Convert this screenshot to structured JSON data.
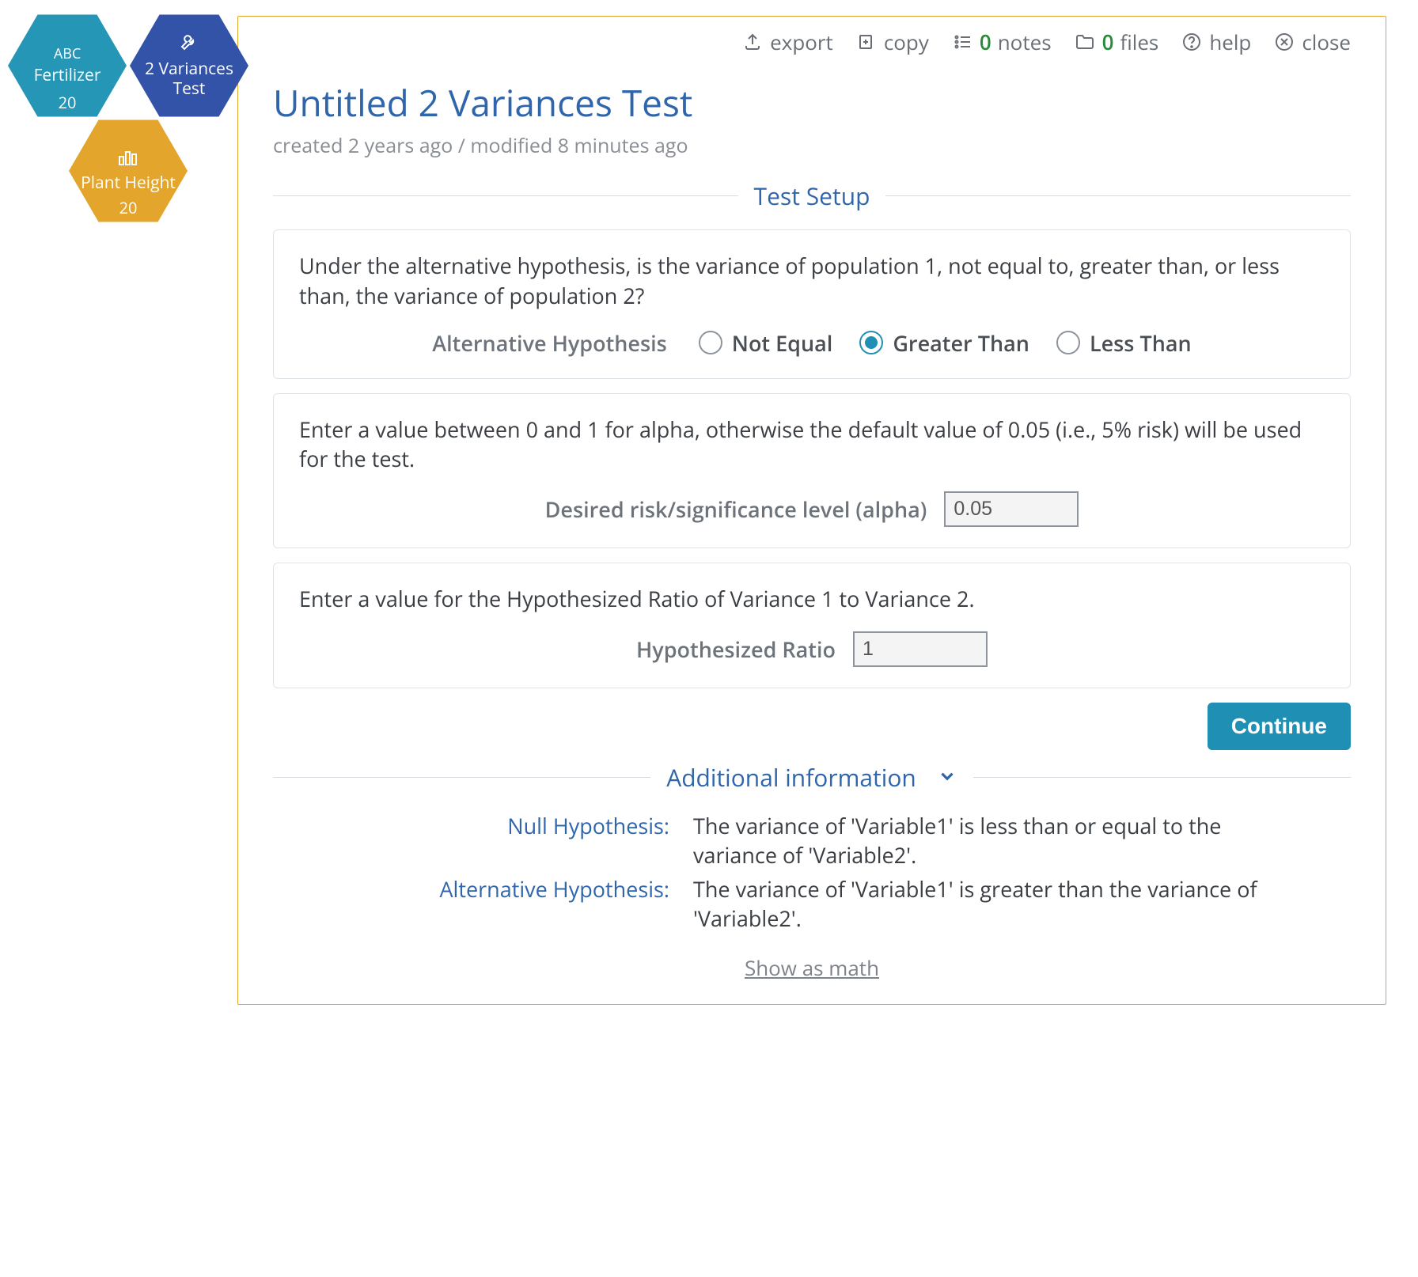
{
  "hex": {
    "fertilizer": {
      "icon": "ABC",
      "label": "Fertilizer",
      "count": "20",
      "fill": "#2696b6"
    },
    "test": {
      "icon": "wrench",
      "label": "2 Variances Test",
      "count": "",
      "fill": "#3353a9"
    },
    "plant": {
      "icon": "bars",
      "label": "Plant Height",
      "count": "20",
      "fill": "#e3a52b"
    }
  },
  "toolbar": {
    "export": "export",
    "copy": "copy",
    "notes_count": "0",
    "notes_label": "notes",
    "files_count": "0",
    "files_label": "files",
    "help": "help",
    "close": "close"
  },
  "title": "Untitled 2 Variances Test",
  "meta": "created 2 years ago / modified 8 minutes ago",
  "sections": {
    "setup": "Test Setup",
    "additional": "Additional information"
  },
  "cards": {
    "hypothesis": {
      "prompt": "Under the alternative hypothesis, is the variance of population 1, not equal to, greater than, or less than, the variance of population 2?",
      "label": "Alternative Hypothesis",
      "options": {
        "not_equal": "Not Equal",
        "greater": "Greater Than",
        "less": "Less Than"
      },
      "selected": "greater"
    },
    "alpha": {
      "prompt": "Enter a value between 0 and 1 for alpha, otherwise the default value of 0.05 (i.e., 5% risk) will be used for the test.",
      "label": "Desired risk/significance level (alpha)",
      "value": "0.05"
    },
    "ratio": {
      "prompt": "Enter a value for the Hypothesized Ratio of Variance 1 to Variance 2.",
      "label": "Hypothesized Ratio",
      "value": "1"
    }
  },
  "continue": "Continue",
  "info": {
    "null_label": "Null Hypothesis:",
    "null_text": "The variance of 'Variable1' is less than or equal to the variance of 'Variable2'.",
    "alt_label": "Alternative Hypothesis:",
    "alt_text": "The variance of 'Variable1' is greater than the variance of 'Variable2'.",
    "show_math": "Show as math"
  }
}
